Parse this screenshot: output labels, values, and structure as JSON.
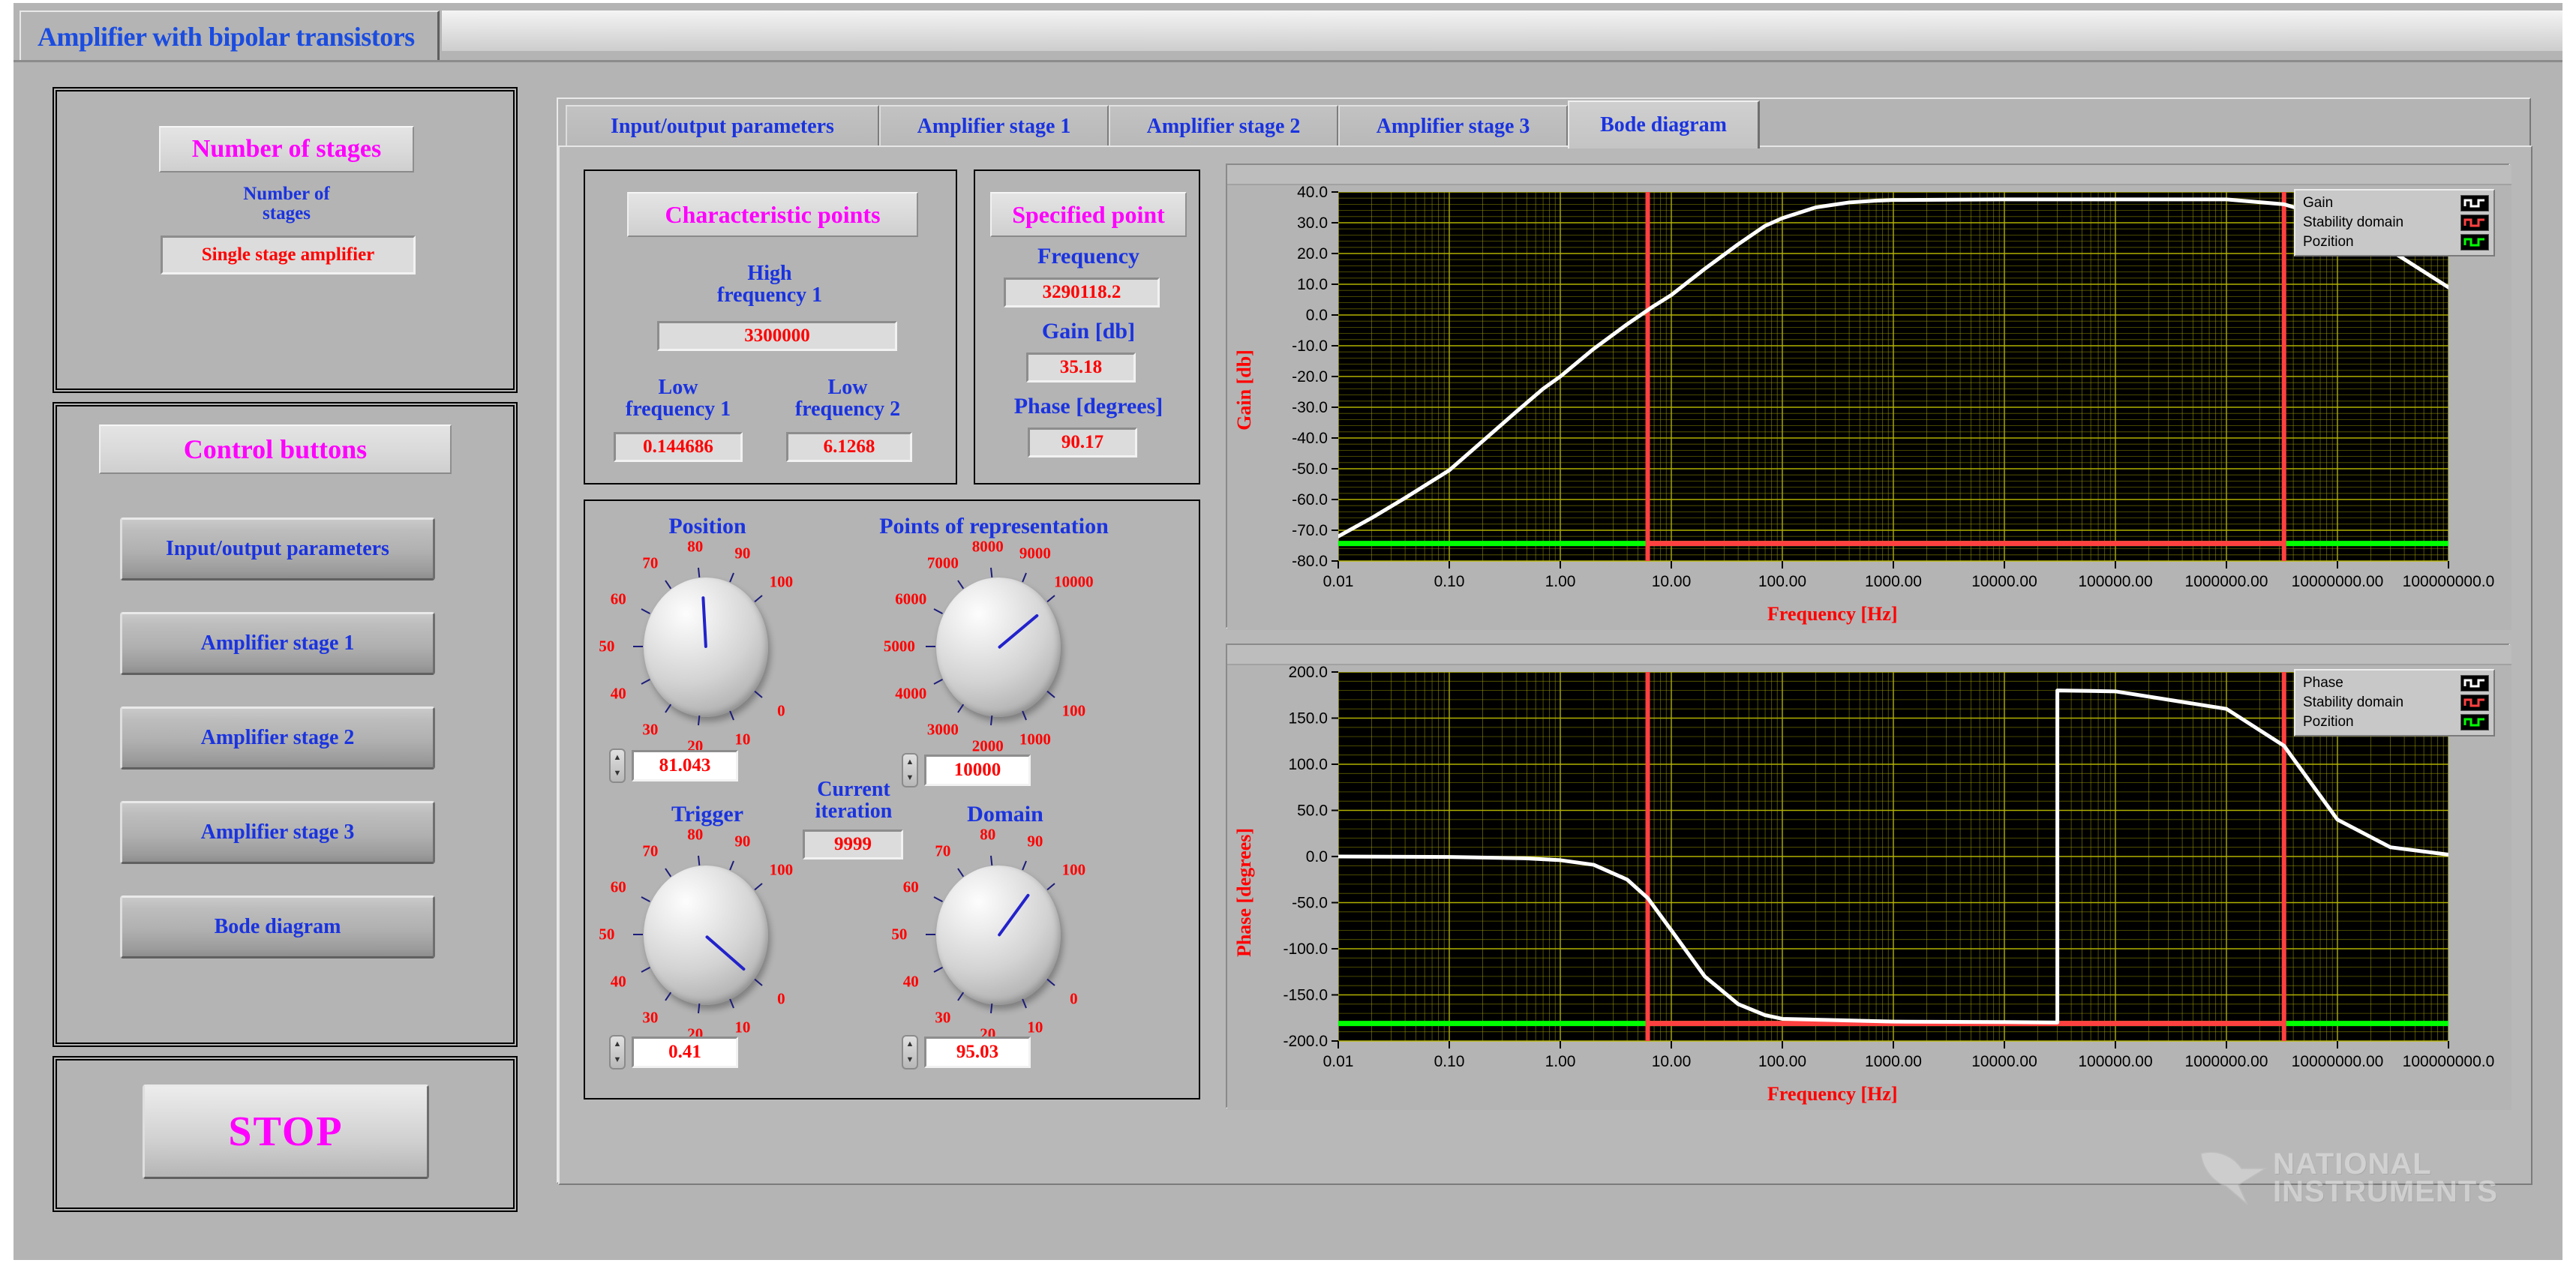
{
  "window": {
    "title": "Amplifier with bipolar transistors"
  },
  "sidebar": {
    "stages": {
      "title": "Number of stages",
      "caption": "Number of\nstages",
      "value": "Single stage amplifier"
    },
    "control": {
      "title": "Control buttons",
      "buttons": [
        {
          "label": "Input/output parameters"
        },
        {
          "label": "Amplifier stage 1"
        },
        {
          "label": "Amplifier stage 2"
        },
        {
          "label": "Amplifier stage 3"
        },
        {
          "label": "Bode diagram"
        }
      ]
    },
    "stop": {
      "label": "STOP"
    }
  },
  "tabs": [
    {
      "label": "Input/output parameters",
      "active": false
    },
    {
      "label": "Amplifier stage 1",
      "active": false
    },
    {
      "label": "Amplifier stage 2",
      "active": false
    },
    {
      "label": "Amplifier stage 3",
      "active": false
    },
    {
      "label": "Bode diagram",
      "active": true
    }
  ],
  "characteristic_points": {
    "title": "Characteristic points",
    "high_frequency_1": {
      "caption": "High\nfrequency 1",
      "value": "3300000"
    },
    "low_frequency_1": {
      "caption": "Low\nfrequency 1",
      "value": "0.144686"
    },
    "low_frequency_2": {
      "caption": "Low\nfrequency 2",
      "value": "6.1268"
    }
  },
  "specified_point": {
    "title": "Specified point",
    "frequency": {
      "caption": "Frequency",
      "value": "3290118.2"
    },
    "gain": {
      "caption": "Gain [db]",
      "value": "35.18"
    },
    "phase": {
      "caption": "Phase [degrees]",
      "value": "90.17"
    }
  },
  "knobs": {
    "position": {
      "caption": "Position",
      "value": "81.043",
      "min": 0,
      "max": 100,
      "ticks": [
        "0",
        "10",
        "20",
        "30",
        "40",
        "50",
        "60",
        "70",
        "80",
        "90",
        "100"
      ]
    },
    "points_of_representation": {
      "caption": "Points of representation",
      "value": "10000",
      "min": 100,
      "max": 10000,
      "ticks": [
        "100",
        "1000",
        "2000",
        "3000",
        "4000",
        "5000",
        "6000",
        "7000",
        "8000",
        "9000",
        "10000"
      ]
    },
    "trigger": {
      "caption": "Trigger",
      "value": "0.41",
      "min": 0,
      "max": 100,
      "ticks": [
        "0",
        "10",
        "20",
        "30",
        "40",
        "50",
        "60",
        "70",
        "80",
        "90",
        "100"
      ]
    },
    "domain": {
      "caption": "Domain",
      "value": "95.03",
      "min": 0,
      "max": 100,
      "ticks": [
        "0",
        "10",
        "20",
        "30",
        "40",
        "50",
        "60",
        "70",
        "80",
        "90",
        "100"
      ]
    },
    "current_iteration": {
      "caption": "Current\niteration",
      "value": "9999"
    }
  },
  "chart_data": [
    {
      "type": "line",
      "title": "Gain",
      "xlabel": "Frequency [Hz]",
      "ylabel": "Gain [db]",
      "xscale": "log",
      "xlim": [
        0.01,
        100000000.0
      ],
      "ylim": [
        -80.0,
        40.0
      ],
      "grid": true,
      "grid_color": "#b9b900",
      "background": "#000000",
      "legend_position": "top-right",
      "xticks": [
        "0.01",
        "0.10",
        "1.00",
        "10.00",
        "100.00",
        "1000.00",
        "10000.00",
        "100000.00",
        "1000000.00",
        "10000000.00",
        "100000000.0"
      ],
      "yticks": [
        "40.0",
        "30.0",
        "20.0",
        "10.0",
        "0.0",
        "-10.0",
        "-20.0",
        "-30.0",
        "-40.0",
        "-50.0",
        "-60.0",
        "-70.0",
        "-80.0"
      ],
      "legend": [
        {
          "name": "Gain",
          "color": "#ffffff"
        },
        {
          "name": "Stability domain",
          "color": "#ff4040"
        },
        {
          "name": "Pozition",
          "color": "#00ff00"
        }
      ],
      "series": [
        {
          "name": "Gain",
          "color": "#ffffff",
          "x": [
            0.01,
            0.02,
            0.04,
            0.07,
            0.1,
            0.2,
            0.4,
            0.7,
            1.0,
            2.0,
            4.0,
            7.0,
            10.0,
            20.0,
            40.0,
            70.0,
            100.0,
            200.0,
            400.0,
            700.0,
            1000.0,
            10000.0,
            100000.0,
            1000000.0,
            3300000.0,
            10000000.0,
            30000000.0,
            100000000.0
          ],
          "y": [
            -72.0,
            -66.0,
            -59.5,
            -54.0,
            -50.5,
            -41.0,
            -31.5,
            -24.0,
            -20.0,
            -11.0,
            -3.0,
            3.0,
            6.5,
            15.0,
            23.0,
            29.0,
            31.5,
            35.0,
            36.6,
            37.2,
            37.4,
            37.6,
            37.6,
            37.6,
            36.0,
            31.0,
            21.0,
            9.0
          ]
        },
        {
          "name": "Stability domain",
          "color": "#ff4040",
          "description": "Vertical boundary markers at 6.1268 Hz and 3300000 Hz spanning full plot height, joined by a horizontal segment near -74 db"
        },
        {
          "name": "Pozition",
          "color": "#00ff00",
          "description": "Horizontal cursor line at approximately -74 db"
        }
      ]
    },
    {
      "type": "line",
      "title": "Phase",
      "xlabel": "Frequency [Hz]",
      "ylabel": "Phase [degrees]",
      "xscale": "log",
      "xlim": [
        0.01,
        100000000.0
      ],
      "ylim": [
        -200.0,
        200.0
      ],
      "grid": true,
      "grid_color": "#b9b900",
      "background": "#000000",
      "legend_position": "top-right",
      "xticks": [
        "0.01",
        "0.10",
        "1.00",
        "10.00",
        "100.00",
        "1000.00",
        "10000.00",
        "100000.00",
        "1000000.00",
        "10000000.00",
        "100000000.0"
      ],
      "yticks": [
        "200.0",
        "150.0",
        "100.0",
        "50.0",
        "0.0",
        "-50.0",
        "-100.0",
        "-150.0",
        "-200.0"
      ],
      "legend": [
        {
          "name": "Phase",
          "color": "#ffffff"
        },
        {
          "name": "Stability domain",
          "color": "#ff4040"
        },
        {
          "name": "Pozition",
          "color": "#00ff00"
        }
      ],
      "series": [
        {
          "name": "Phase",
          "color": "#ffffff",
          "x": [
            0.01,
            0.1,
            0.5,
            1.0,
            2.0,
            4.0,
            6.1268,
            10.0,
            20.0,
            40.0,
            70.0,
            100.0,
            1000.0,
            10000.0,
            30000.0,
            30001.0,
            100000.0,
            1000000.0,
            3300000.0,
            10000000.0,
            30000000.0,
            100000000.0
          ],
          "y": [
            0.0,
            -0.5,
            -2.0,
            -4.0,
            -9.0,
            -25.0,
            -45.0,
            -80.0,
            -130.0,
            -160.0,
            -172.0,
            -176.0,
            -179.0,
            -179.5,
            -180.0,
            180.0,
            179.0,
            160.0,
            120.0,
            40.0,
            10.0,
            2.0
          ]
        },
        {
          "name": "Stability domain",
          "color": "#ff4040",
          "description": "Vertical boundary markers at 6.1268 Hz and 3300000 Hz spanning full plot height, joined by horizontal segment near -185 degrees"
        },
        {
          "name": "Pozition",
          "color": "#00ff00",
          "description": "Horizontal cursor line at approximately -185 degrees"
        }
      ]
    }
  ],
  "branding": {
    "line1": "NATIONAL",
    "line2": "INSTRUMENTS"
  }
}
